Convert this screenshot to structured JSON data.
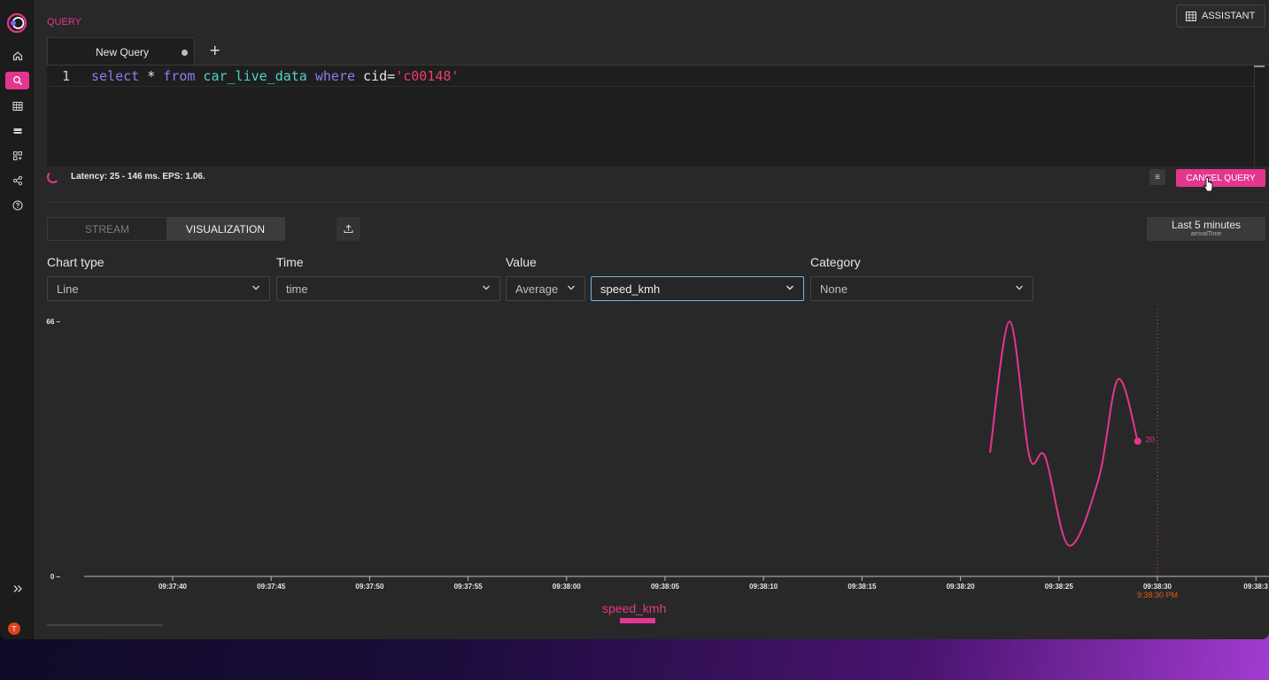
{
  "app": {
    "section_label": "QUERY",
    "assistant_label": "ASSISTANT",
    "avatar_initial": "T",
    "accent_color": "#e3368e"
  },
  "sidebar": {
    "items": [
      {
        "icon": "home-icon"
      },
      {
        "icon": "search-icon",
        "active": true
      },
      {
        "icon": "table-icon"
      },
      {
        "icon": "stream-icon"
      },
      {
        "icon": "apps-icon"
      },
      {
        "icon": "share-icon"
      },
      {
        "icon": "help-icon"
      }
    ],
    "expand_icon": "chevron-double-right-icon"
  },
  "editor": {
    "tab_label": "New Query",
    "add_tab": "+",
    "line_number": "1",
    "tokens": {
      "kw_select": "select",
      "star": " * ",
      "kw_from": "from",
      "table": " car_live_data ",
      "kw_where": "where",
      "cond": " cid=",
      "literal": "'c00148'"
    }
  },
  "status": {
    "text": "Latency: 25 - 146 ms.  EPS: 1.06.",
    "cancel_label": "CANCEL QUERY",
    "menu_glyph": "≡"
  },
  "view": {
    "stream_label": "STREAM",
    "visualization_label": "VISUALIZATION",
    "time_range": "Last 5 minutes",
    "time_field": "arrivalTime"
  },
  "controls": {
    "chart_type_label": "Chart type",
    "chart_type_value": "Line",
    "time_label": "Time",
    "time_value": "time",
    "value_label": "Value",
    "agg_value": "Average",
    "field_value": "speed_kmh",
    "category_label": "Category",
    "category_value": "None"
  },
  "chart_data": {
    "type": "line",
    "title": "",
    "xlabel": "",
    "ylabel": "",
    "ylim": [
      0,
      66
    ],
    "y_ticks": [
      "66",
      "0"
    ],
    "x_ticks": [
      "09:37:40",
      "09:37:45",
      "09:37:50",
      "09:37:55",
      "09:38:00",
      "09:38:05",
      "09:38:10",
      "09:38:15",
      "09:38:20",
      "09:38:25",
      "09:38:30",
      "09:38:3"
    ],
    "series": [
      {
        "name": "speed_kmh",
        "color": "#e3368e",
        "x": [
          "09:38:21.5",
          "09:38:22.5",
          "09:38:23.5",
          "09:38:24.3",
          "09:38:25.5",
          "09:38:27",
          "09:38:28",
          "09:38:29"
        ],
        "values": [
          32,
          66,
          31,
          31,
          8,
          25,
          51,
          35
        ]
      }
    ],
    "last_point_label": "20.",
    "now_marker": {
      "time": "09:38:30",
      "label": "9:38:30 PM",
      "color": "#e05a1e"
    },
    "legend": "speed_kmh",
    "legend_position": "bottom"
  }
}
